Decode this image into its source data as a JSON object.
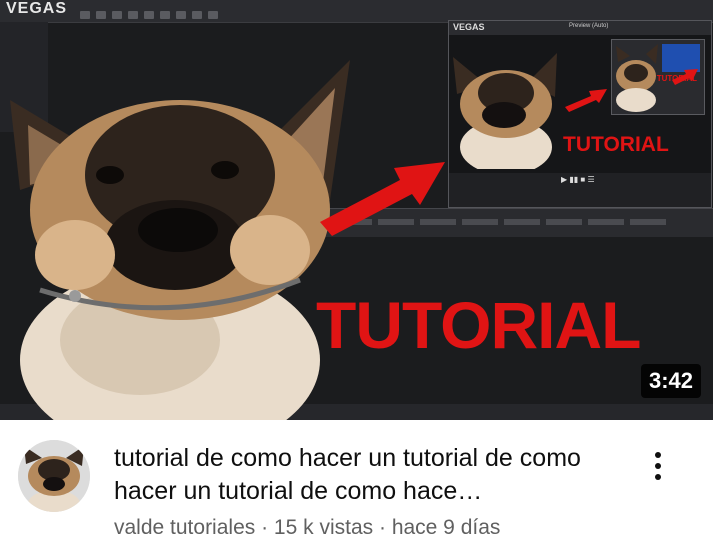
{
  "thumbnail": {
    "editor_logo": "VEGAS",
    "inner_editor_logo": "VEGAS",
    "inner_preview_label": "Preview (Auto)",
    "inner_tutorial_text": "TUTORIAL",
    "inner_mini_text": "TUTORIAL",
    "tutorial_text": "TUTORIAL",
    "duration": "3:42",
    "colors": {
      "tutorial_red": "#e01414",
      "editor_bg": "#1b1c1e",
      "arrow": "#e01414"
    }
  },
  "video": {
    "title": "tutorial de como hacer un tutorial de como hacer un tutorial de como hace…",
    "channel": "valde tutoriales",
    "separator": " · ",
    "views": "15 k vistas",
    "age": "hace 9 días"
  },
  "icons": {
    "more": "vertical-ellipsis-icon",
    "avatar": "dog-avatar"
  }
}
